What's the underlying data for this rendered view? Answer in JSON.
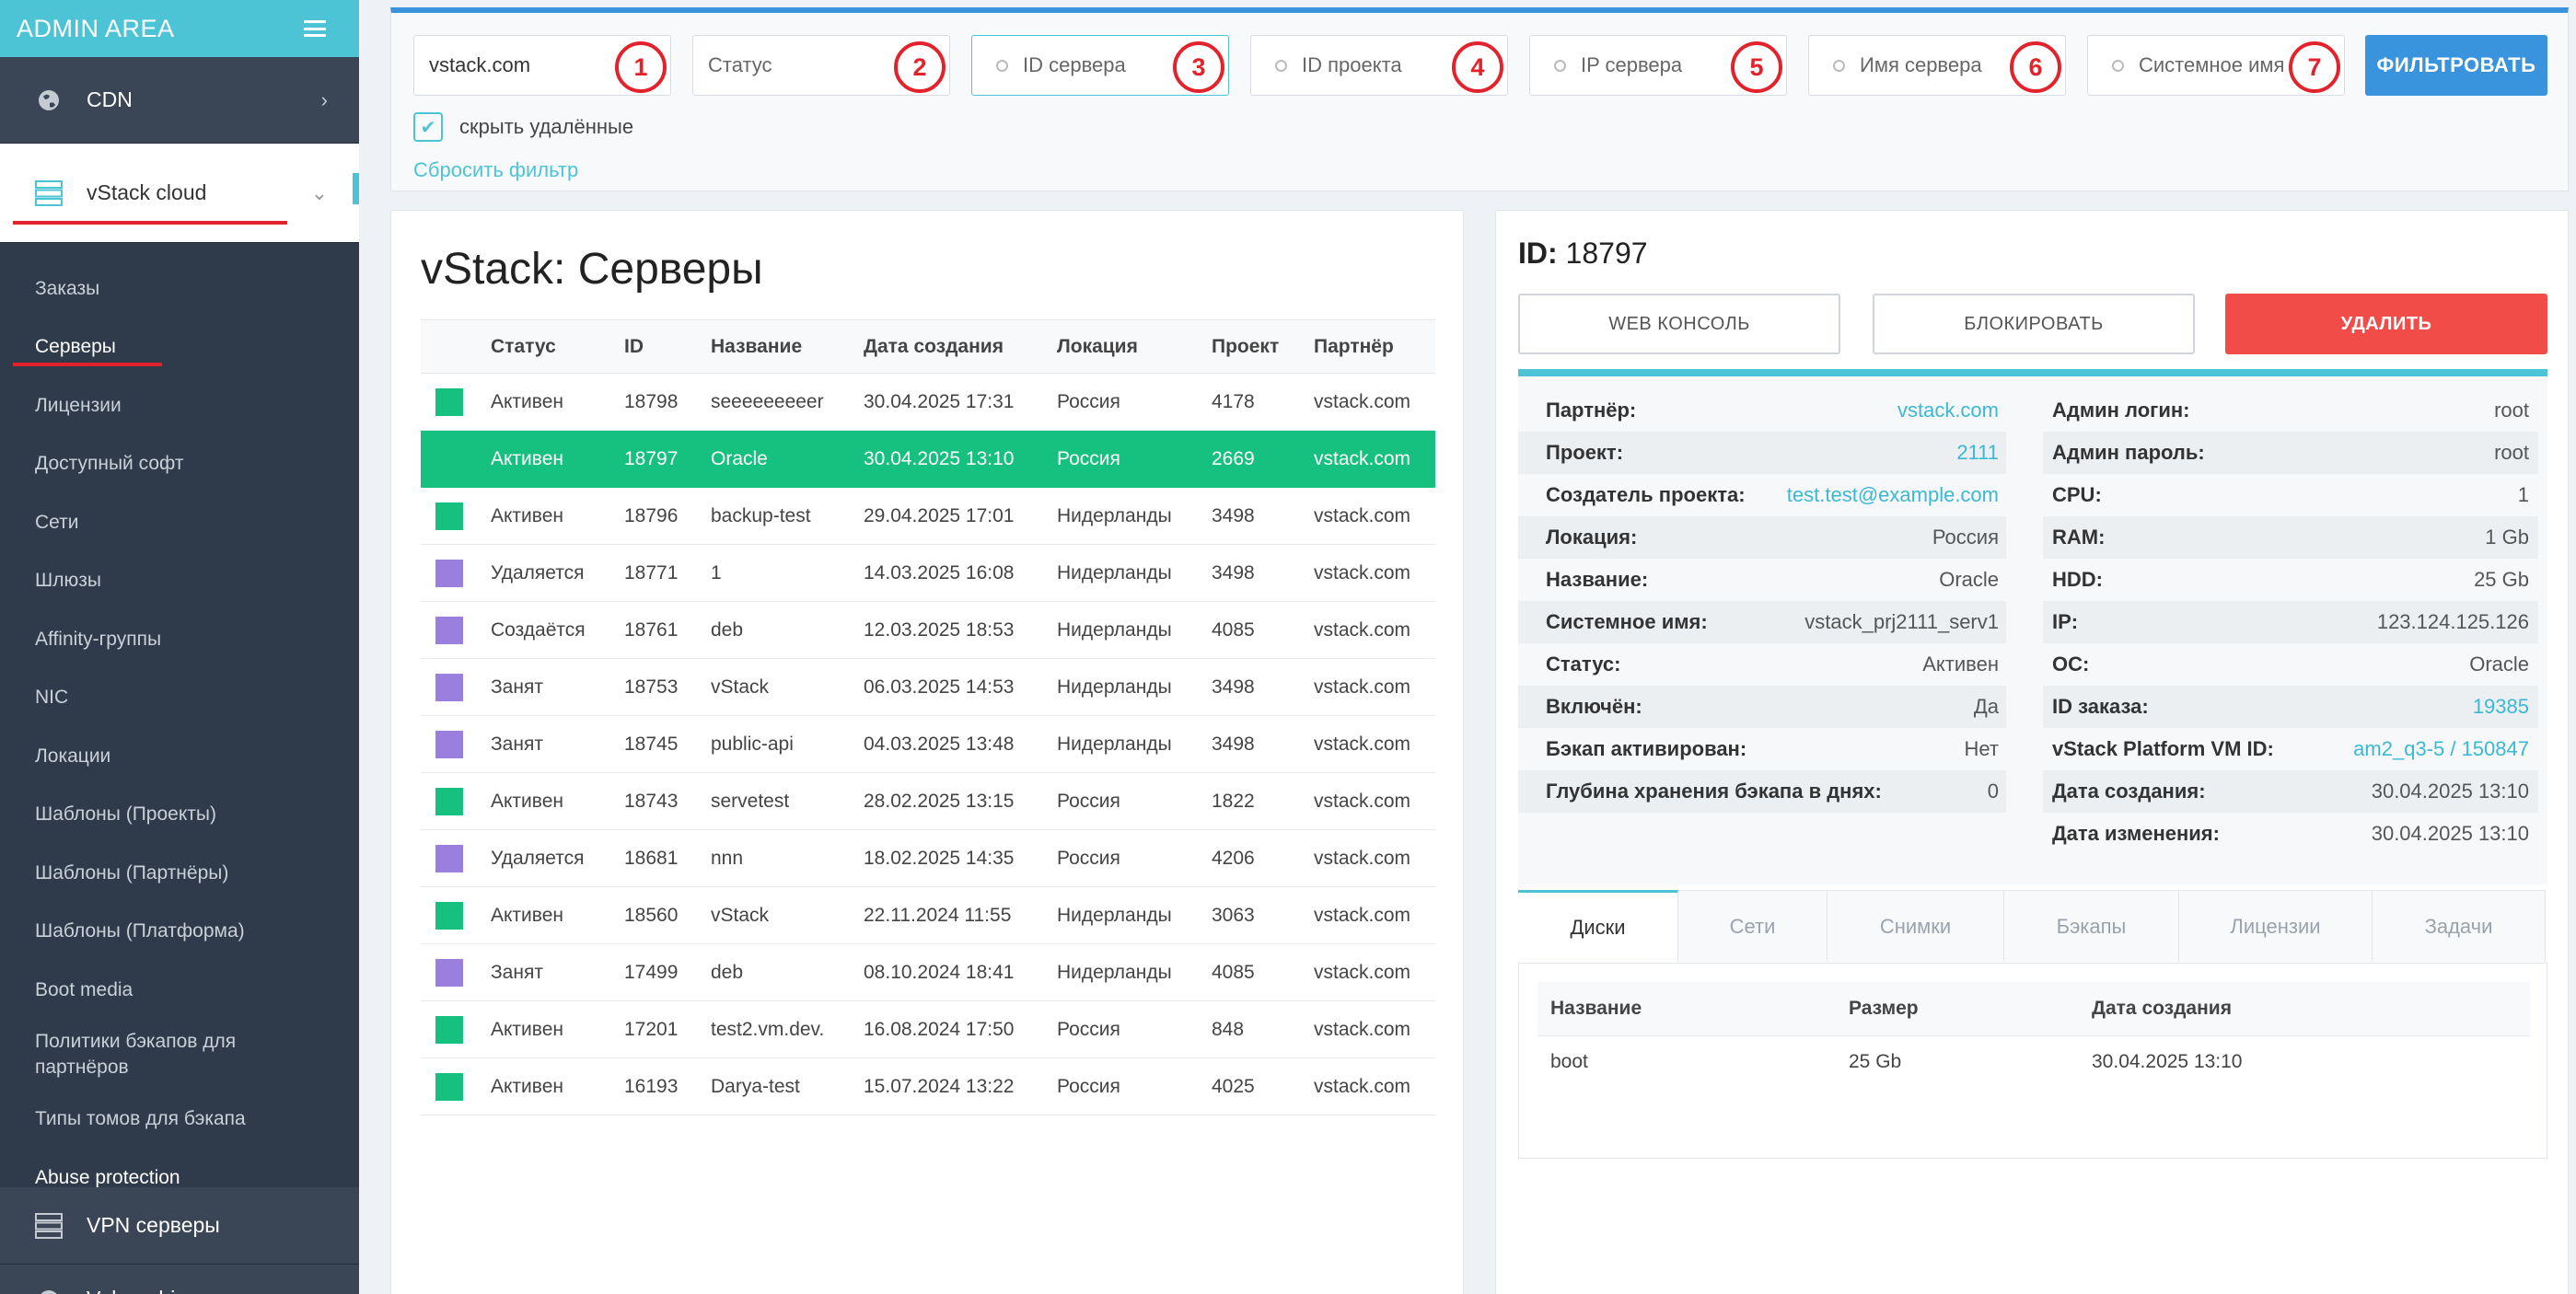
{
  "sidebar": {
    "brand": "ADMIN AREA",
    "sections": {
      "cdn": "CDN",
      "vstack": "vStack cloud",
      "vpn": "VPN серверы",
      "partial": "Vulnerabi..."
    },
    "items": [
      "Заказы",
      "Серверы",
      "Лицензии",
      "Доступный софт",
      "Сети",
      "Шлюзы",
      "Affinity-группы",
      "NIC",
      "Локации",
      "Шаблоны (Проекты)",
      "Шаблоны (Партнёры)",
      "Шаблоны (Платформа)",
      "Boot media",
      "Политики бэкапов для партнёров",
      "Типы томов для бэкапа",
      "Abuse protection"
    ]
  },
  "filters": {
    "partner_value": "vstack.com",
    "status_value": "Статус",
    "server_id": "ID сервера",
    "project_id": "ID проекта",
    "server_ip": "IP сервера",
    "server_name": "Имя сервера",
    "system_name": "Системное имя",
    "badges": [
      "1",
      "2",
      "3",
      "4",
      "5",
      "6",
      "7"
    ],
    "filter_button": "ФИЛЬТРОВАТЬ",
    "hide_deleted_label": "скрыть удалённые",
    "hide_deleted_checked": true,
    "reset_link": "Сбросить фильтр"
  },
  "servers": {
    "title": "vStack: Серверы",
    "columns": [
      "Статус",
      "ID",
      "Название",
      "Дата создания",
      "Локация",
      "Проект",
      "Партнёр"
    ],
    "rows": [
      {
        "color": "green",
        "status": "Активен",
        "id": "18798",
        "name": "seeeeeeeeer",
        "created": "30.04.2025 17:31",
        "location": "Россия",
        "project": "4178",
        "partner": "vstack.com"
      },
      {
        "color": "green",
        "status": "Активен",
        "id": "18797",
        "name": "Oracle",
        "created": "30.04.2025 13:10",
        "location": "Россия",
        "project": "2669",
        "partner": "vstack.com",
        "selected": true
      },
      {
        "color": "green",
        "status": "Активен",
        "id": "18796",
        "name": "backup-test",
        "created": "29.04.2025 17:01",
        "location": "Нидерланды",
        "project": "3498",
        "partner": "vstack.com"
      },
      {
        "color": "purple",
        "status": "Удаляется",
        "id": "18771",
        "name": "1",
        "created": "14.03.2025 16:08",
        "location": "Нидерланды",
        "project": "3498",
        "partner": "vstack.com"
      },
      {
        "color": "purple",
        "status": "Создаётся",
        "id": "18761",
        "name": "deb",
        "created": "12.03.2025 18:53",
        "location": "Нидерланды",
        "project": "4085",
        "partner": "vstack.com"
      },
      {
        "color": "purple",
        "status": "Занят",
        "id": "18753",
        "name": "vStack",
        "created": "06.03.2025 14:53",
        "location": "Нидерланды",
        "project": "3498",
        "partner": "vstack.com"
      },
      {
        "color": "purple",
        "status": "Занят",
        "id": "18745",
        "name": "public-api",
        "created": "04.03.2025 13:48",
        "location": "Нидерланды",
        "project": "3498",
        "partner": "vstack.com"
      },
      {
        "color": "green",
        "status": "Активен",
        "id": "18743",
        "name": "servetest",
        "created": "28.02.2025 13:15",
        "location": "Россия",
        "project": "1822",
        "partner": "vstack.com"
      },
      {
        "color": "purple",
        "status": "Удаляется",
        "id": "18681",
        "name": "nnn",
        "created": "18.02.2025 14:35",
        "location": "Россия",
        "project": "4206",
        "partner": "vstack.com"
      },
      {
        "color": "green",
        "status": "Активен",
        "id": "18560",
        "name": "vStack",
        "created": "22.11.2024 11:55",
        "location": "Нидерланды",
        "project": "3063",
        "partner": "vstack.com"
      },
      {
        "color": "purple",
        "status": "Занят",
        "id": "17499",
        "name": "deb",
        "created": "08.10.2024 18:41",
        "location": "Нидерланды",
        "project": "4085",
        "partner": "vstack.com"
      },
      {
        "color": "green",
        "status": "Активен",
        "id": "17201",
        "name": "test2.vm.dev.",
        "created": "16.08.2024 17:50",
        "location": "Россия",
        "project": "848",
        "partner": "vstack.com"
      },
      {
        "color": "green",
        "status": "Активен",
        "id": "16193",
        "name": "Darya-test",
        "created": "15.07.2024 13:22",
        "location": "Россия",
        "project": "4025",
        "partner": "vstack.com"
      }
    ]
  },
  "detail": {
    "id_label": "ID:",
    "id_value": "18797",
    "buttons": {
      "console": "WEB КОНСОЛЬ",
      "block": "БЛОКИРОВАТЬ",
      "delete": "УДАЛИТЬ"
    },
    "left": [
      {
        "k": "Партнёр:",
        "v": "vstack.com",
        "link": true
      },
      {
        "k": "Проект:",
        "v": "2111",
        "link": true
      },
      {
        "k": "Создатель проекта:",
        "v": "test.test@example.com",
        "link": true
      },
      {
        "k": "Локация:",
        "v": "Россия"
      },
      {
        "k": "Название:",
        "v": "Oracle"
      },
      {
        "k": "Системное имя:",
        "v": "vstack_prj2111_serv1"
      },
      {
        "k": "Статус:",
        "v": "Активен"
      },
      {
        "k": "Включён:",
        "v": "Да"
      },
      {
        "k": "Бэкап активирован:",
        "v": "Нет"
      },
      {
        "k": "Глубина хранения бэкапа в днях:",
        "v": "0"
      }
    ],
    "right": [
      {
        "k": "Админ логин:",
        "v": "root"
      },
      {
        "k": "Админ пароль:",
        "v": "root"
      },
      {
        "k": "CPU:",
        "v": "1"
      },
      {
        "k": "RAM:",
        "v": "1 Gb"
      },
      {
        "k": "HDD:",
        "v": "25 Gb"
      },
      {
        "k": "IP:",
        "v": "123.124.125.126"
      },
      {
        "k": "ОС:",
        "v": "Oracle"
      },
      {
        "k": "ID заказа:",
        "v": "19385",
        "link": true
      },
      {
        "k": "vStack Platform VM ID:",
        "v": "am2_q3-5 / 150847",
        "link": true
      },
      {
        "k": "Дата создания:",
        "v": "30.04.2025 13:10"
      },
      {
        "k": "Дата изменения:",
        "v": "30.04.2025 13:10"
      }
    ],
    "tabs": [
      "Диски",
      "Сети",
      "Снимки",
      "Бэкапы",
      "Лицензии",
      "Задачи"
    ],
    "disks": {
      "columns": [
        "Название",
        "Размер",
        "Дата создания"
      ],
      "rows": [
        {
          "name": "boot",
          "size": "25 Gb",
          "created": "30.04.2025 13:10"
        }
      ]
    }
  },
  "colors": {
    "accent": "#4dc4d6",
    "primary": "#3a93dd",
    "active": "#16c07f",
    "busy": "#9b7fde",
    "danger": "#f24c48",
    "annotation": "#e3232b"
  }
}
